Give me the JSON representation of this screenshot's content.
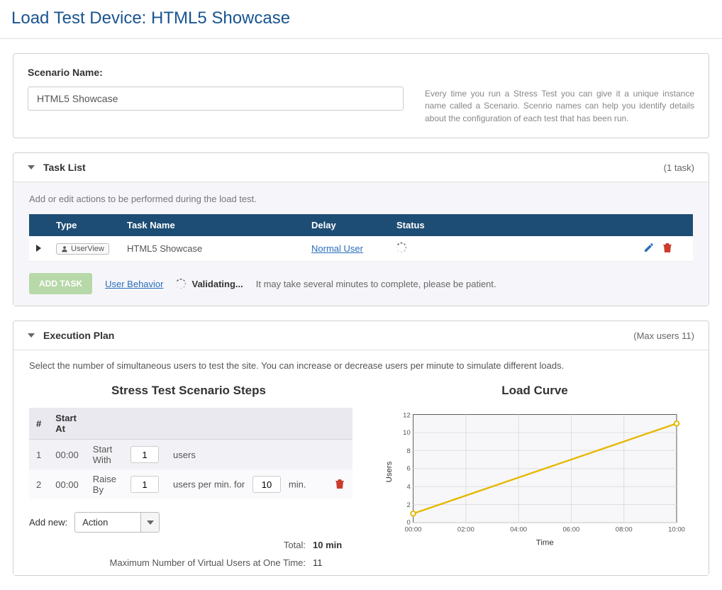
{
  "page_title": "Load Test Device: HTML5 Showcase",
  "scenario": {
    "label": "Scenario Name:",
    "value": "HTML5 Showcase",
    "help": "Every time you run a Stress Test you can give it a unique instance name called a Scenario. Scenrio names can help you identify details about the configuration of each test that has been run."
  },
  "task_list": {
    "title": "Task List",
    "count_label": "(1 task)",
    "hint": "Add or edit actions to be performed during the load test.",
    "columns": {
      "type": "Type",
      "name": "Task Name",
      "delay": "Delay",
      "status": "Status"
    },
    "rows": [
      {
        "type_label": "UserView",
        "name": "HTML5 Showcase",
        "delay": "Normal User"
      }
    ],
    "add_button": "ADD TASK",
    "user_behavior_link": "User Behavior",
    "validating": "Validating...",
    "patience": "It may take several minutes to complete, please be patient."
  },
  "execution": {
    "title": "Execution Plan",
    "meta": "(Max users 11)",
    "hint": "Select the number of simultaneous users to test the site. You can increase or decrease users per minute to simulate different loads.",
    "steps_title": "Stress Test Scenario Steps",
    "columns": {
      "num": "#",
      "start": "Start At"
    },
    "steps": [
      {
        "num": "1",
        "start": "00:00",
        "action": "Start With",
        "v1": "1",
        "suffix": "users"
      },
      {
        "num": "2",
        "start": "00:00",
        "action": "Raise By",
        "v1": "1",
        "mid": "users per min. for",
        "v2": "10",
        "suffix": "min."
      }
    ],
    "add_new_label": "Add new:",
    "add_new_select": "Action",
    "total_label": "Total:",
    "total_value": "10 min",
    "max_users_label": "Maximum Number of Virtual Users at One Time:",
    "max_users_value": "11",
    "curve_title": "Load Curve"
  },
  "chart_data": {
    "type": "line",
    "title": "Load Curve",
    "xlabel": "Time",
    "ylabel": "Users",
    "x_ticks": [
      "00:00",
      "02:00",
      "04:00",
      "06:00",
      "08:00",
      "10:00"
    ],
    "y_ticks": [
      0,
      2,
      4,
      6,
      8,
      10,
      12
    ],
    "ylim": [
      0,
      12
    ],
    "series": [
      {
        "name": "Users",
        "color": "#e6b800",
        "x": [
          "00:00",
          "10:00"
        ],
        "values": [
          1,
          11
        ]
      }
    ]
  }
}
